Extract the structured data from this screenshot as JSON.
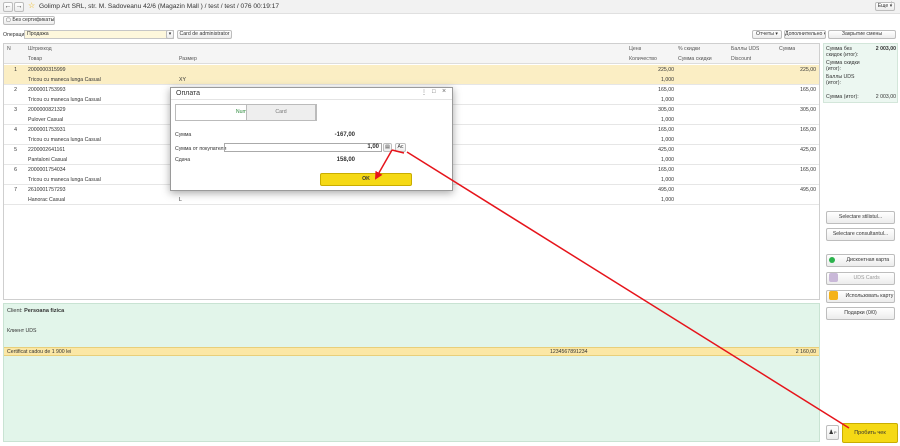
{
  "window": {
    "title": "Golimp Art SRL, str. M. Sadoveanu 42/6 (Magazin Mall ) / test / test / 076 00:19:17",
    "back_icon": "arrow-left-icon",
    "forward_icon": "arrow-right-icon",
    "star_icon": "star-icon",
    "more_label": "Еще"
  },
  "toolbar": {
    "no_fiscal_label": "Без сертификаты",
    "operation_label": "Операция:",
    "operation_value": "Продажа",
    "card_admin_label": "Card de administrator",
    "reports_label": "Отчеты",
    "additional_label": "Дополнительно",
    "close_shift_label": "Закрытие смены"
  },
  "grid": {
    "headers": {
      "n": "N",
      "barcode": "Штрихкод",
      "product": "Товар",
      "size": "Размер",
      "price": "Цена",
      "qty": "Количество",
      "discount_pct": "% скидки",
      "discount_sum": "Сумма скидки",
      "uds_bonus": "Баллы UDS",
      "uds_discount": "Discount",
      "sum": "Сумма"
    },
    "rows": [
      {
        "n": "1",
        "barcode": "2000000315999",
        "product": "Tricou cu maneca lunga Casual",
        "size": "XY",
        "price": "225,00",
        "qty": "1,000",
        "sum": "225,00"
      },
      {
        "n": "2",
        "barcode": "2000001753993",
        "product": "Tricou cu maneca lunga Casual",
        "size": "",
        "price": "165,00",
        "qty": "1,000",
        "sum": "165,00"
      },
      {
        "n": "3",
        "barcode": "2000000821329",
        "product": "Pulover Casual",
        "size": "",
        "price": "305,00",
        "qty": "1,000",
        "sum": "305,00"
      },
      {
        "n": "4",
        "barcode": "2000001753931",
        "product": "Tricou cu maneca lunga Casual",
        "size": "",
        "price": "165,00",
        "qty": "1,000",
        "sum": "165,00"
      },
      {
        "n": "5",
        "barcode": "2200002641161",
        "product": "Pantaloni Casual",
        "size": "",
        "price": "425,00",
        "qty": "1,000",
        "sum": "425,00"
      },
      {
        "n": "6",
        "barcode": "2000001754034",
        "product": "Tricou cu maneca lunga Casual",
        "size": "",
        "price": "165,00",
        "qty": "1,000",
        "sum": "165,00"
      },
      {
        "n": "7",
        "barcode": "2610001757293",
        "product": "Hanorac Casual",
        "size": "L",
        "price": "495,00",
        "qty": "1,000",
        "sum": "495,00"
      }
    ]
  },
  "client": {
    "label": "Client:",
    "name": "Persoana fizica",
    "uds_label": "Клиент UDS",
    "cert_name": "Certificat cadou de 1 900 lei",
    "cert_code": "1234567891234",
    "cert_sum": "2 160,00"
  },
  "totals": {
    "sum_no_discount_label": "Сумма без скидок (итог):",
    "sum_no_discount_value": "2 003,00",
    "discount_label": "Сумма скидки (итог):",
    "uds_label": "Баллы UDS (итог):",
    "total_label": "Сумма (итог):",
    "total_value": "2 003,00"
  },
  "side": {
    "select_stilist": "Selectare stilistul...",
    "select_consultant": "Selectare consultantul...",
    "discount_card": "Дисконтная карта",
    "uds_card": "UDS Cards",
    "use_card": "Использовать карту",
    "gifts": "Подарки (0/0)",
    "person_icon_label": "P",
    "print_check": "Пробить чек"
  },
  "dialog": {
    "title": "Оплата",
    "tab_cash": "Numerar",
    "tab_card": "Card",
    "sum_label": "Сумма",
    "sum_value": "-167,00",
    "paid_label": "Сумма от покупателя",
    "paid_value": "1,00",
    "change_label": "Сдача",
    "change_value": "158,00",
    "calc_label": "Ac",
    "ok_label": "OK"
  },
  "colors": {
    "accent_yellow": "#f5d915",
    "selected_row": "#fbeec4",
    "panel_green": "#e2f5ea",
    "arrow_red": "#e6141b"
  }
}
